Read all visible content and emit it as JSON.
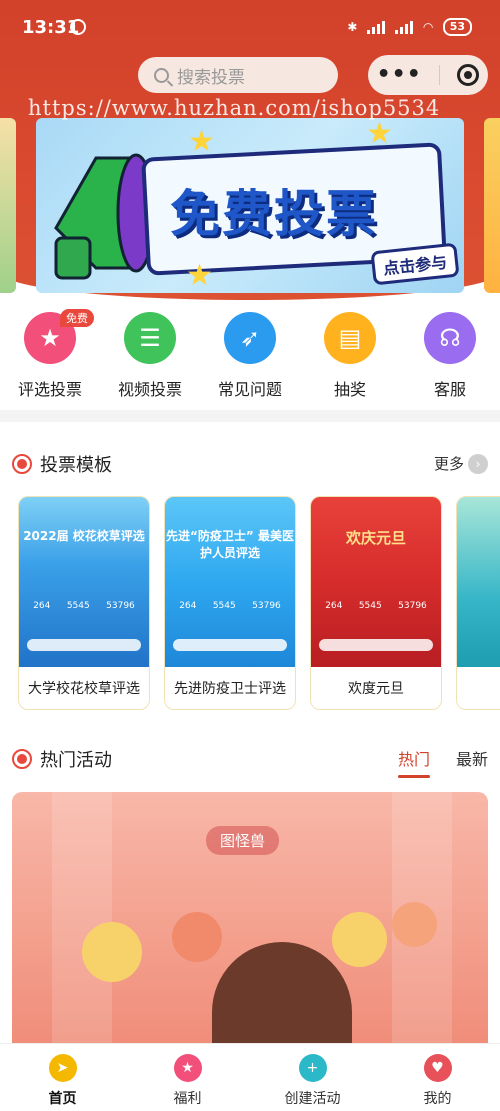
{
  "status_bar": {
    "time": "13:31",
    "battery": "53",
    "network": "HD"
  },
  "search": {
    "placeholder": "搜索投票"
  },
  "watermark": "https://www.huzhan.com/ishop5534",
  "banner": {
    "title": "免费投票",
    "cta": "点击参与"
  },
  "quick_actions": [
    {
      "label": "评选投票",
      "icon": "star-icon",
      "color": "#f2507a",
      "badge": "免费"
    },
    {
      "label": "视频投票",
      "icon": "chat-icon",
      "color": "#3fc35a"
    },
    {
      "label": "常见问题",
      "icon": "compass-icon",
      "color": "#2b9bf0"
    },
    {
      "label": "抽奖",
      "icon": "clipboard-icon",
      "color": "#ffb21e"
    },
    {
      "label": "客服",
      "icon": "headset-icon",
      "color": "#9a6cf0"
    }
  ],
  "templates_section": {
    "title": "投票模板",
    "more": "更多"
  },
  "templates": [
    {
      "name": "大学校花校草评选",
      "thumb_title": "2022届 校花校草评选",
      "stats": [
        "264",
        "5545",
        "53796"
      ],
      "color": "#3aa0e8"
    },
    {
      "name": "先进防疫卫士评选",
      "thumb_title": "先进“防疫卫士” 最美医护人员评选",
      "stats": [
        "264",
        "5545",
        "53796"
      ],
      "color": "#2fa8f0"
    },
    {
      "name": "欢度元旦",
      "thumb_title": "欢庆元旦",
      "stats": [
        "264",
        "5545",
        "53796"
      ],
      "color": "#d62c2c"
    },
    {
      "name": "",
      "thumb_title": "",
      "stats": [],
      "color": "#37b6c8"
    }
  ],
  "activities_section": {
    "title": "热门活动",
    "tabs": [
      "热门",
      "最新"
    ]
  },
  "activity": {
    "stamp": "图怪兽"
  },
  "tabbar": [
    {
      "label": "首页",
      "icon": "rocket-icon",
      "color": "#f5b800",
      "current": true
    },
    {
      "label": "福利",
      "icon": "star-icon",
      "color": "#f2507a",
      "current": false
    },
    {
      "label": "创建活动",
      "icon": "plus-icon",
      "color": "#2bb8c8",
      "current": false
    },
    {
      "label": "我的",
      "icon": "heart-icon",
      "color": "#e8505a",
      "current": false
    }
  ]
}
